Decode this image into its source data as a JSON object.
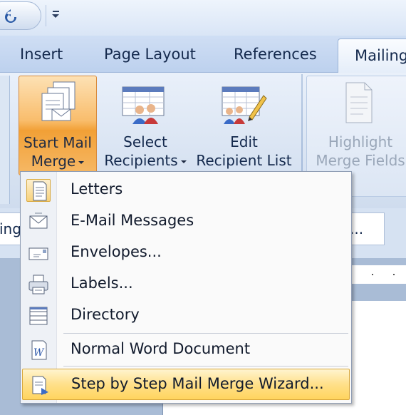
{
  "tabs": {
    "insert": "Insert",
    "page_layout": "Page Layout",
    "references": "References",
    "mailings": "Mailings"
  },
  "ribbon": {
    "start_mail_merge": {
      "line1": "Start Mail",
      "line2": "Merge"
    },
    "select_recipients": {
      "line1": "Select",
      "line2": "Recipients"
    },
    "edit_recipient_list": {
      "line1": "Edit",
      "line2": "Recipient List"
    },
    "highlight_merge_fields": {
      "line1": "Highlight",
      "line2": "Merge Fields"
    }
  },
  "strip": {
    "left_partial": "ing",
    "right_partial": "..."
  },
  "menu": {
    "items": [
      {
        "label": "Letters",
        "icon": "letter-document-icon",
        "checked": true
      },
      {
        "label": "E-Mail Messages",
        "icon": "envelope-email-icon"
      },
      {
        "label": "Envelopes...",
        "icon": "envelope-icon"
      },
      {
        "label": "Labels...",
        "icon": "labels-printer-icon"
      },
      {
        "label": "Directory",
        "icon": "directory-list-icon"
      },
      {
        "label": "Normal Word Document",
        "icon": "word-document-icon"
      },
      {
        "label": "Step by Step Mail Merge Wizard...",
        "icon": "wizard-document-icon",
        "highlighted": true
      }
    ]
  },
  "colors": {
    "accent_orange": "#f2a036",
    "menu_highlight": "#ffe08a",
    "ribbon_blue": "#cfdcee"
  }
}
